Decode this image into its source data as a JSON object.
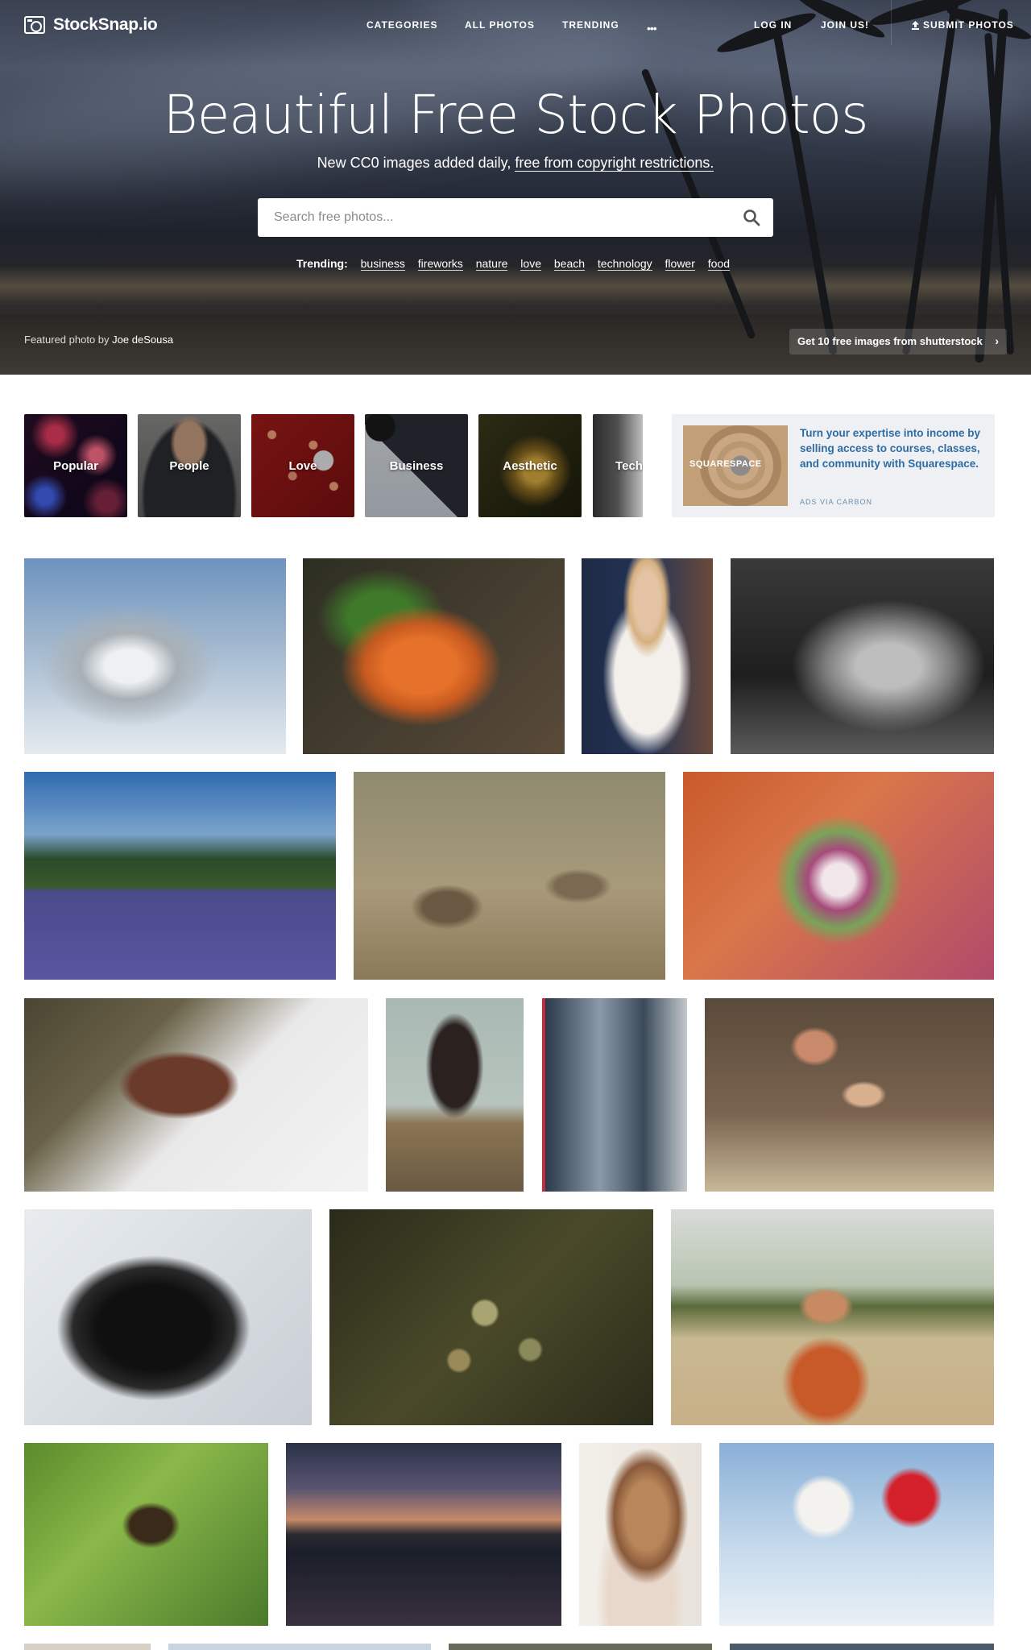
{
  "brand": {
    "name": "StockSnap.io"
  },
  "nav": {
    "categories": "CATEGORIES",
    "all_photos": "ALL PHOTOS",
    "trending": "TRENDING",
    "more": "•••",
    "login": "LOG IN",
    "join": "JOIN US!",
    "submit": "SUBMIT PHOTOS"
  },
  "hero": {
    "title": "Beautiful Free Stock Photos",
    "subtitle_prefix": "New CC0 images added daily, ",
    "subtitle_link": "free from copyright restrictions.",
    "search_placeholder": "Search free photos...",
    "trending_label": "Trending:",
    "trending_tags": [
      "business",
      "fireworks",
      "nature",
      "love",
      "beach",
      "technology",
      "flower",
      "food"
    ],
    "featured_prefix": "Featured photo by",
    "featured_author": "Joe deSousa",
    "shutterstock_cta": "Get 10 free images from shutterstock"
  },
  "categories": [
    "Popular",
    "People",
    "Love",
    "Business",
    "Aesthetic",
    "Tech"
  ],
  "ad": {
    "brand": "SQUARESPACE",
    "text": "Turn your expertise into income by selling access to courses, classes, and community with Squarespace.",
    "via": "ADS VIA CARBON"
  },
  "colors": {
    "ad_text": "#2e6ca4",
    "ad_background": "#eef0f3"
  },
  "photos": [
    {
      "name": "snowy-pine-tree"
    },
    {
      "name": "carrots-market"
    },
    {
      "name": "woman-with-tablet"
    },
    {
      "name": "sneakers-on-grass"
    },
    {
      "name": "mountain-lupine-field"
    },
    {
      "name": "monkeys-on-ground"
    },
    {
      "name": "dahlia-bud"
    },
    {
      "name": "aerial-snowy-house"
    },
    {
      "name": "woman-on-bench"
    },
    {
      "name": "traffic-light-building"
    },
    {
      "name": "father-son-reading"
    },
    {
      "name": "camera-dial"
    },
    {
      "name": "green-buds"
    },
    {
      "name": "woman-behind-fence"
    },
    {
      "name": "bird-on-branch"
    },
    {
      "name": "sunset-lake-mountain"
    },
    {
      "name": "woman-profile-window"
    },
    {
      "name": "red-white-flowers"
    }
  ]
}
